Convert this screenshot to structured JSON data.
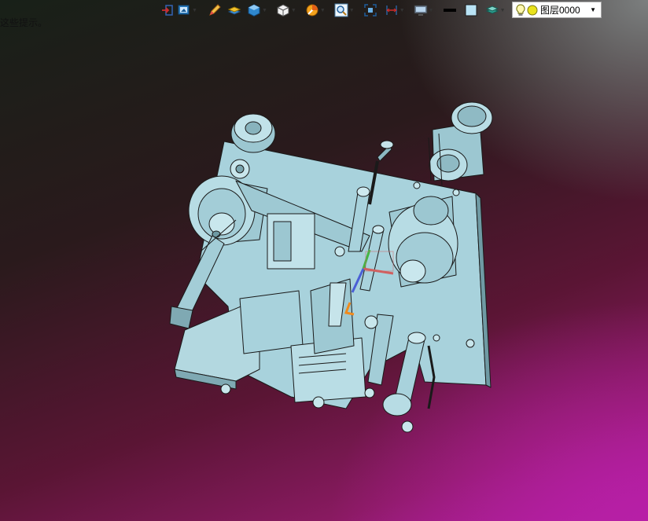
{
  "hint_text": "这些提示。",
  "toolbar": {
    "buttons": [
      {
        "icon": "exit-sketch-icon",
        "has_menu": false
      },
      {
        "icon": "view-orientation-icon",
        "has_menu": true
      },
      {
        "icon": "pencil-icon",
        "has_menu": false
      },
      {
        "icon": "hide-show-items-icon",
        "has_menu": false
      },
      {
        "icon": "display-style-icon",
        "has_menu": true
      },
      {
        "icon": "view-cube-icon",
        "has_menu": true
      },
      {
        "icon": "section-view-icon",
        "has_menu": true
      },
      {
        "icon": "zoom-icon",
        "has_menu": true
      },
      {
        "icon": "fit-view-icon",
        "has_menu": false
      },
      {
        "icon": "dimension-icon",
        "has_menu": true
      },
      {
        "icon": "monitor-icon",
        "has_menu": true
      },
      {
        "icon": "line-color-icon",
        "has_menu": false
      },
      {
        "icon": "fill-color-icon",
        "has_menu": false
      },
      {
        "icon": "layers-icon",
        "has_menu": true
      }
    ],
    "layer_select": {
      "value": "图层0000",
      "bulb_icon": "lightbulb-icon",
      "sun_icon": "layer-on-icon"
    }
  },
  "viewport": {
    "model": "machine-assembly",
    "model_color": "#a9d3dc",
    "background_colors": [
      "#182018",
      "#5a1534",
      "#b41fa4",
      "#7c7f7f"
    ]
  }
}
